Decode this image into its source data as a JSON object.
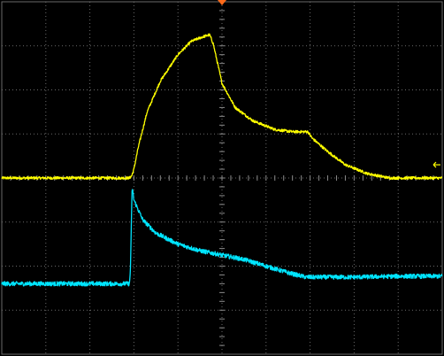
{
  "chart_data": {
    "type": "line",
    "title": "",
    "xlabel": "",
    "ylabel": "",
    "grid": true,
    "graticule": {
      "x_divisions": 10,
      "y_divisions": 8,
      "minor_per_division": 5
    },
    "xlim": [
      0,
      10
    ],
    "ylim": [
      -4,
      4
    ],
    "trigger_marker": {
      "x_div": 5.0
    },
    "level_marker": {
      "y_div": 0.3,
      "side": "right"
    },
    "series": [
      {
        "color": "#ffff00",
        "x": [
          0,
          1,
          2,
          2.9,
          2.95,
          3.0,
          3.1,
          3.3,
          3.6,
          4.0,
          4.3,
          4.55,
          4.72,
          4.8,
          5.0,
          5.3,
          5.7,
          6.2,
          6.6,
          6.95,
          7.05,
          7.4,
          7.8,
          8.3,
          8.8,
          9.3,
          9.7,
          10
        ],
        "values": [
          0.0,
          0.0,
          0.0,
          0.0,
          0.05,
          0.2,
          0.7,
          1.5,
          2.2,
          2.8,
          3.1,
          3.2,
          3.25,
          3.05,
          2.15,
          1.6,
          1.3,
          1.1,
          1.05,
          1.05,
          0.9,
          0.6,
          0.3,
          0.1,
          0.0,
          0.0,
          0.0,
          0.0
        ],
        "noise": 0.03
      },
      {
        "color": "#00e5ff",
        "x": [
          0,
          1,
          2,
          2.9,
          2.92,
          2.96,
          3.0,
          3.2,
          3.5,
          4.0,
          4.5,
          5.0,
          5.5,
          6.0,
          6.5,
          6.9,
          7.5,
          8.0,
          9.0,
          10
        ],
        "values": [
          -2.4,
          -2.4,
          -2.4,
          -2.4,
          -2.1,
          -0.2,
          -0.5,
          -0.95,
          -1.25,
          -1.5,
          -1.65,
          -1.75,
          -1.85,
          -2.0,
          -2.15,
          -2.25,
          -2.25,
          -2.25,
          -2.23,
          -2.23
        ],
        "noise": 0.05
      }
    ]
  }
}
